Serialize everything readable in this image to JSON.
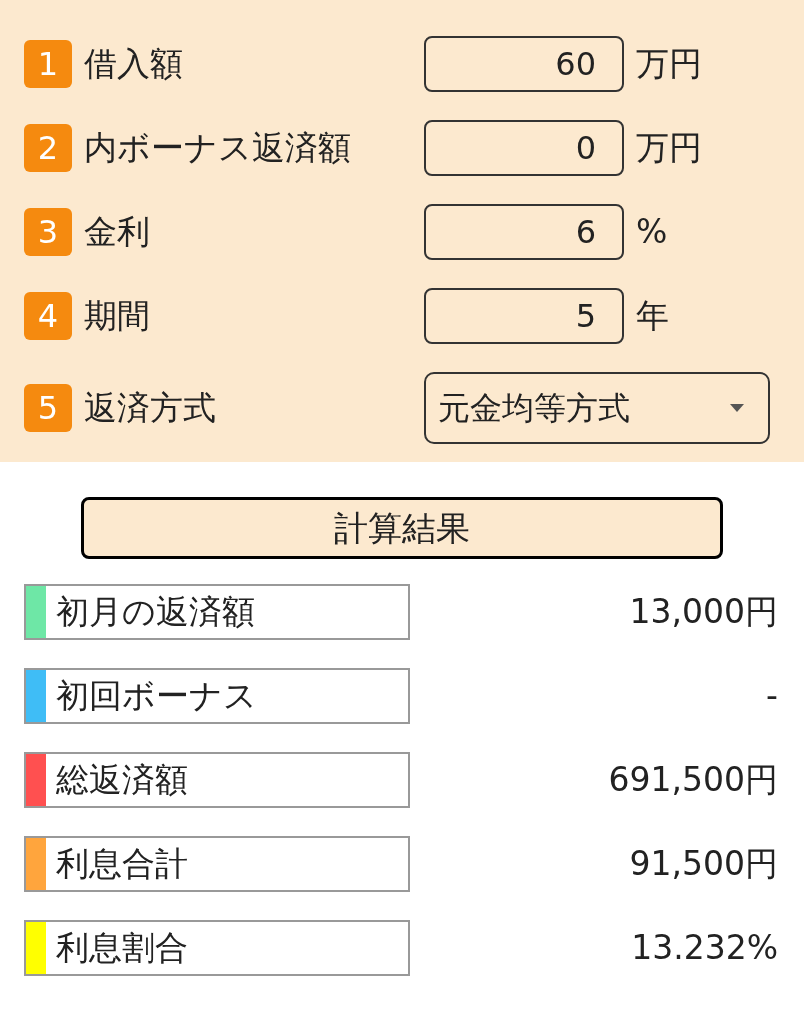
{
  "inputs": [
    {
      "number": "1",
      "label": "借入額",
      "kind": "input",
      "value": "60",
      "unit": "万円"
    },
    {
      "number": "2",
      "label": "内ボーナス返済額",
      "kind": "input",
      "value": "0",
      "unit": "万円"
    },
    {
      "number": "3",
      "label": "金利",
      "kind": "input",
      "value": "6",
      "unit": "%"
    },
    {
      "number": "4",
      "label": "期間",
      "kind": "input",
      "value": "5",
      "unit": "年"
    },
    {
      "number": "5",
      "label": "返済方式",
      "kind": "select",
      "value": "元金均等方式"
    }
  ],
  "calculate_button": "計算結果",
  "results": [
    {
      "label": "初月の返済額",
      "color": "#6ee7a6",
      "value": "13,000円"
    },
    {
      "label": "初回ボーナス",
      "color": "#3fbdf6",
      "value": "-"
    },
    {
      "label": "総返済額",
      "color": "#ff5050",
      "value": "691,500円"
    },
    {
      "label": "利息合計",
      "color": "#ffa53d",
      "value": "91,500円"
    },
    {
      "label": "利息割合",
      "color": "#ffff00",
      "value": "13.232%"
    }
  ]
}
